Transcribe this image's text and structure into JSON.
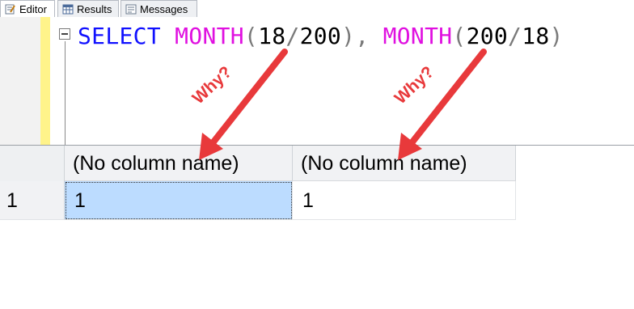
{
  "tabs": [
    {
      "label": "Editor",
      "icon": "editor-icon",
      "active": true
    },
    {
      "label": "Results",
      "icon": "grid-icon",
      "active": false
    },
    {
      "label": "Messages",
      "icon": "messages-icon",
      "active": false
    }
  ],
  "editor": {
    "tokens": {
      "select": "SELECT",
      "fn1": "MONTH",
      "open1": "(",
      "arg1a": "18",
      "div1": "/",
      "arg1b": "200",
      "close1": ")",
      "comma": ",",
      "fn2": "MONTH",
      "open2": "(",
      "arg2a": "200",
      "div2": "/",
      "arg2b": "18",
      "close2": ")"
    },
    "fold_icon": "collapse-minus-icon"
  },
  "results": {
    "columns": [
      "(No column name)",
      "(No column name)"
    ],
    "rows": [
      {
        "row_number": "1",
        "cells": [
          "1",
          "1"
        ]
      }
    ]
  },
  "annotations": [
    {
      "text": "Why?",
      "color": "#e8393b"
    },
    {
      "text": "Why?",
      "color": "#e8393b"
    }
  ],
  "colors": {
    "keyword": "#1010ff",
    "function": "#e010e0",
    "selected_cell": "#bcdcff",
    "change_bar": "#fff38a",
    "arrow": "#e8393b"
  }
}
